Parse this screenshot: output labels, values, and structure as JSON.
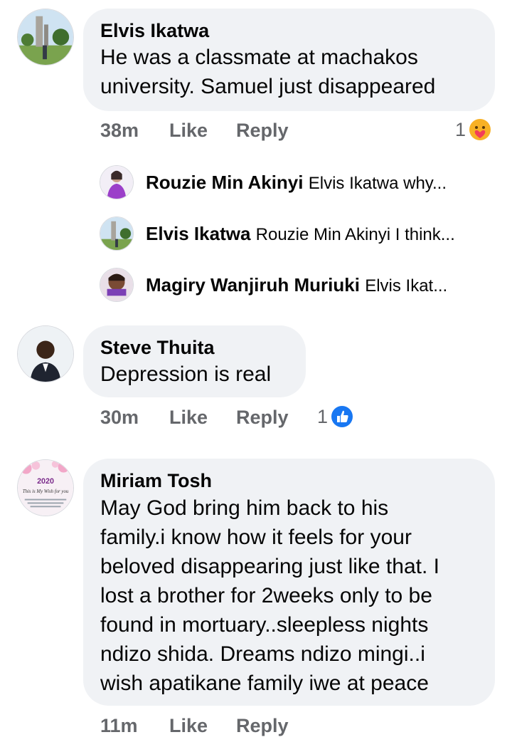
{
  "comments": [
    {
      "author": "Elvis Ikatwa",
      "lines": [
        "He was a classmate at machakos",
        "university. Samuel just disappeared"
      ],
      "time": "38m",
      "like": "Like",
      "reply": "Reply",
      "reaction_count": "1",
      "reaction_icon": "care-reaction-icon"
    },
    {
      "author": "Steve Thuita",
      "lines": [
        "Depression is real"
      ],
      "time": "30m",
      "like": "Like",
      "reply": "Reply",
      "reaction_count": "1",
      "reaction_icon": "like-reaction-icon"
    },
    {
      "author": "Miriam Tosh",
      "lines": [
        "May God bring him back to his",
        "family.i know how it feels for your",
        "beloved disappearing just like that. I",
        "lost a brother for 2weeks only to be",
        "found in mortuary..sleepless nights",
        "ndizo shida. Dreams ndizo mingi..i",
        "wish apatikane family iwe at peace"
      ],
      "time": "11m",
      "like": "Like",
      "reply": "Reply"
    }
  ],
  "replies": [
    {
      "name": "Rouzie Min Akinyi",
      "preview": "Elvis Ikatwa why..."
    },
    {
      "name": "Elvis Ikatwa",
      "preview": "Rouzie Min Akinyi I think..."
    },
    {
      "name": "Magiry Wanjiruh Muriuki",
      "preview": "Elvis Ikat..."
    }
  ],
  "avatar_text": {
    "miriam_year": "2020",
    "miriam_title": "This is My Wish for you"
  },
  "colors": {
    "bubble": "#f0f2f5",
    "meta": "#65676b",
    "like_blue": "#1877f2",
    "care_yellow": "#f7b125"
  }
}
